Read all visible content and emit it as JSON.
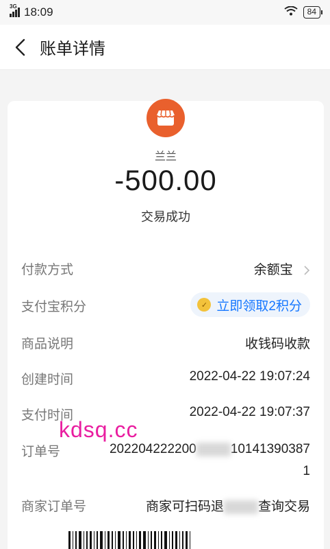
{
  "status_bar": {
    "network": "3G",
    "time": "18:09",
    "battery": "84"
  },
  "nav": {
    "title": "账单详情"
  },
  "merchant": {
    "name": "兰兰",
    "amount": "-500.00",
    "status": "交易成功"
  },
  "details": {
    "payment_method": {
      "label": "付款方式",
      "value": "余额宝"
    },
    "points": {
      "label": "支付宝积分",
      "value": "立即领取2积分"
    },
    "product": {
      "label": "商品说明",
      "value": "收钱码收款"
    },
    "created": {
      "label": "创建时间",
      "value": "2022-04-22 19:07:24"
    },
    "paid": {
      "label": "支付时间",
      "value": "2022-04-22 19:07:37"
    },
    "order_no": {
      "label": "订单号",
      "value_part1": "202204222200",
      "value_part2": "10141390387",
      "value_line2": "1"
    },
    "merchant_order": {
      "label": "商家订单号",
      "value_part1": "商家可扫码退",
      "value_part2": "查询交易"
    }
  },
  "watermark": "kdsq.cc",
  "colors": {
    "accent": "#1677ff",
    "merchant_logo": "#e9602d",
    "watermark": "#e91ea0"
  }
}
